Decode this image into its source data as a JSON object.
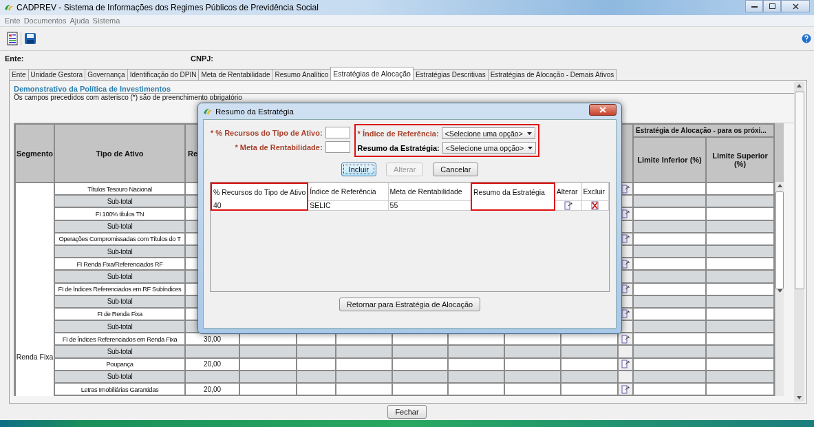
{
  "window": {
    "title": "CADPREV - Sistema de Informações dos Regimes Públicos de Previdência Social"
  },
  "menu": [
    "Ente",
    "Documentos",
    "Ajuda",
    "Sistema"
  ],
  "header_fields": [
    {
      "label": "Ente:"
    },
    {
      "label": "CNPJ:"
    }
  ],
  "tabs": [
    {
      "label": "Ente",
      "selected": false
    },
    {
      "label": "Unidade Gestora",
      "selected": false
    },
    {
      "label": "Governança",
      "selected": false
    },
    {
      "label": "Identificação do DPIN",
      "selected": false
    },
    {
      "label": "Meta de Rentabilidade",
      "selected": false
    },
    {
      "label": "Resumo Analítico",
      "selected": false
    },
    {
      "label": "Estratégias de Alocação",
      "selected": true
    },
    {
      "label": "Estratégias Descritivas",
      "selected": false
    },
    {
      "label": "Estratégias de Alocação - Demais Ativos",
      "selected": false
    }
  ],
  "section": {
    "title": "Demonstrativo da Política de Investimentos",
    "note": "Os campos precedidos com asterisco (*) são de preenchimento obrigatório"
  },
  "table": {
    "headers": {
      "segment": "Segmento",
      "asset_type": "Tipo de Ativo",
      "column_3": "Re",
      "group": "Estratégia de Alocação - para os próxi...",
      "limits": [
        "Limite Inferior (%)",
        "Limite Superior (%)"
      ]
    },
    "segment": "Renda Fixa",
    "rows": [
      {
        "kind": "asset",
        "asset_type": "Títulos Tesouro Nacional"
      },
      {
        "kind": "subtotal",
        "asset_type": "Sub-total"
      },
      {
        "kind": "asset",
        "asset_type": "FI 100% títulos TN"
      },
      {
        "kind": "subtotal",
        "asset_type": "Sub-total"
      },
      {
        "kind": "asset",
        "asset_type": "Operações Compromissadas com Títulos do T"
      },
      {
        "kind": "subtotal",
        "asset_type": "Sub-total"
      },
      {
        "kind": "asset",
        "asset_type": "FI Renda Fixa/Referenciados RF"
      },
      {
        "kind": "subtotal",
        "asset_type": "Sub-total"
      },
      {
        "kind": "asset",
        "asset_type": "FI de Índices Referenciados em RF Subíndices"
      },
      {
        "kind": "subtotal",
        "asset_type": "Sub-total"
      },
      {
        "kind": "asset",
        "asset_type": "FI de Renda Fixa"
      },
      {
        "kind": "subtotal",
        "asset_type": "Sub-total"
      },
      {
        "kind": "asset",
        "asset_type": "FI de Índices Referenciados em Renda Fixa",
        "value": "30,00"
      },
      {
        "kind": "subtotal",
        "asset_type": "Sub-total"
      },
      {
        "kind": "asset",
        "asset_type": "Poupança",
        "value": "20,00"
      },
      {
        "kind": "subtotal",
        "asset_type": "Sub-total"
      },
      {
        "kind": "asset",
        "asset_type": "Letras Imobiliárias Garantidas",
        "value": "20,00"
      }
    ]
  },
  "dialog": {
    "title": "Resumo da Estratégia",
    "inputs": [
      {
        "label": "* % Recursos do Tipo de Ativo:",
        "required": true
      },
      {
        "label": "* Meta de Rentabilidade:",
        "required": true
      }
    ],
    "selects_highlighted": true,
    "selects": [
      {
        "label": "* Índice de Referência:",
        "required": true,
        "value": "<Selecione uma opção>"
      },
      {
        "label": "Resumo da Estratégia:",
        "required": false,
        "value": "<Selecione uma opção>"
      }
    ],
    "buttons": [
      {
        "label": "Incluir",
        "disabled": false,
        "focused": true
      },
      {
        "label": "Alterar",
        "disabled": true,
        "focused": false
      },
      {
        "label": "Cancelar",
        "disabled": false,
        "focused": false
      }
    ],
    "grid": {
      "columns": [
        {
          "label": "% Recursos do Tipo de Ativo",
          "highlighted": true
        },
        {
          "label": "Índice de Referência",
          "highlighted": false
        },
        {
          "label": "Meta de Rentabilidade",
          "highlighted": false
        },
        {
          "label": "Resumo da Estratégia",
          "highlighted": true
        },
        {
          "label": "Alterar",
          "highlighted": false
        },
        {
          "label": "Excluir",
          "highlighted": false
        }
      ],
      "rows": [
        {
          "cells": [
            "40",
            "SELIC",
            "55"
          ]
        }
      ]
    },
    "return_button": "Retornar para Estratégia de Alocação"
  },
  "close_button": "Fechar"
}
